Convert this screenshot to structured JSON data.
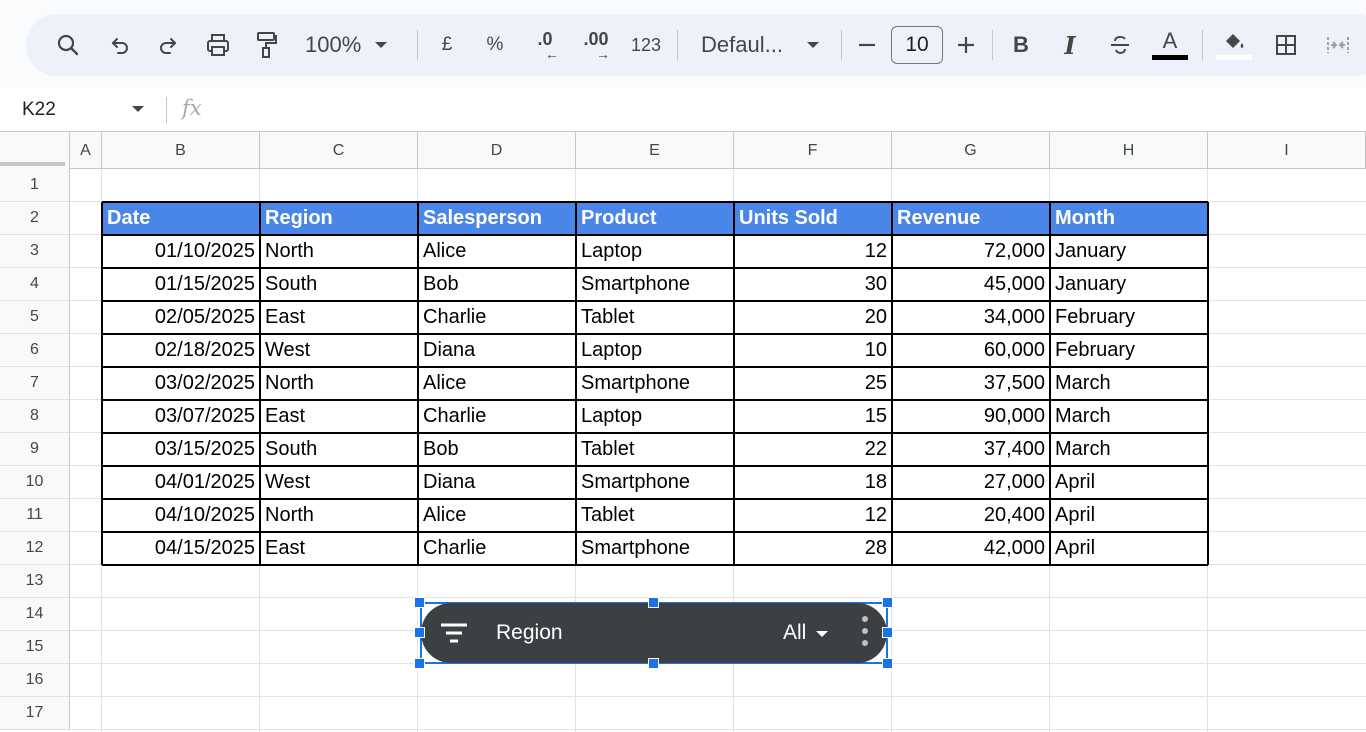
{
  "toolbar": {
    "zoom": "100%",
    "currency_symbol": "£",
    "percent_symbol": "%",
    "decrease_decimal": ".0",
    "increase_decimal": ".00",
    "number_format": "123",
    "font_name": "Defaul...",
    "font_size": "10",
    "bold_label": "B",
    "italic_label": "I",
    "text_color_label": "A",
    "text_color": "#000000",
    "icons": [
      "search-icon",
      "undo-icon",
      "redo-icon",
      "print-icon",
      "paint-format-icon",
      "decrease-font-icon",
      "increase-font-icon",
      "strikethrough-icon",
      "fill-color-icon",
      "borders-icon",
      "merge-cells-icon"
    ]
  },
  "formula_bar": {
    "cell_ref": "K22",
    "fx_label": "fx"
  },
  "columns": [
    "A",
    "B",
    "C",
    "D",
    "E",
    "F",
    "G",
    "H",
    "I"
  ],
  "rows": [
    "1",
    "2",
    "3",
    "4",
    "5",
    "6",
    "7",
    "8",
    "9",
    "10",
    "11",
    "12",
    "13",
    "14",
    "15",
    "16",
    "17"
  ],
  "table": {
    "header_color": "#4a86e8",
    "headers": [
      "Date",
      "Region",
      "Salesperson",
      "Product",
      "Units Sold",
      "Revenue",
      "Month"
    ],
    "rows": [
      [
        "01/10/2025",
        "North",
        "Alice",
        "Laptop",
        "12",
        "72,000",
        "January"
      ],
      [
        "01/15/2025",
        "South",
        "Bob",
        "Smartphone",
        "30",
        "45,000",
        "January"
      ],
      [
        "02/05/2025",
        "East",
        "Charlie",
        "Tablet",
        "20",
        "34,000",
        "February"
      ],
      [
        "02/18/2025",
        "West",
        "Diana",
        "Laptop",
        "10",
        "60,000",
        "February"
      ],
      [
        "03/02/2025",
        "North",
        "Alice",
        "Smartphone",
        "25",
        "37,500",
        "March"
      ],
      [
        "03/07/2025",
        "East",
        "Charlie",
        "Laptop",
        "15",
        "90,000",
        "March"
      ],
      [
        "03/15/2025",
        "South",
        "Bob",
        "Tablet",
        "22",
        "37,400",
        "March"
      ],
      [
        "04/01/2025",
        "West",
        "Diana",
        "Smartphone",
        "18",
        "27,000",
        "April"
      ],
      [
        "04/10/2025",
        "North",
        "Alice",
        "Tablet",
        "12",
        "20,400",
        "April"
      ],
      [
        "04/15/2025",
        "East",
        "Charlie",
        "Smartphone",
        "28",
        "42,000",
        "April"
      ]
    ]
  },
  "filter_chip": {
    "label": "Region",
    "value": "All",
    "icon": "filter-icon",
    "background": "#3c4043",
    "selection_color": "#1a73e8"
  }
}
